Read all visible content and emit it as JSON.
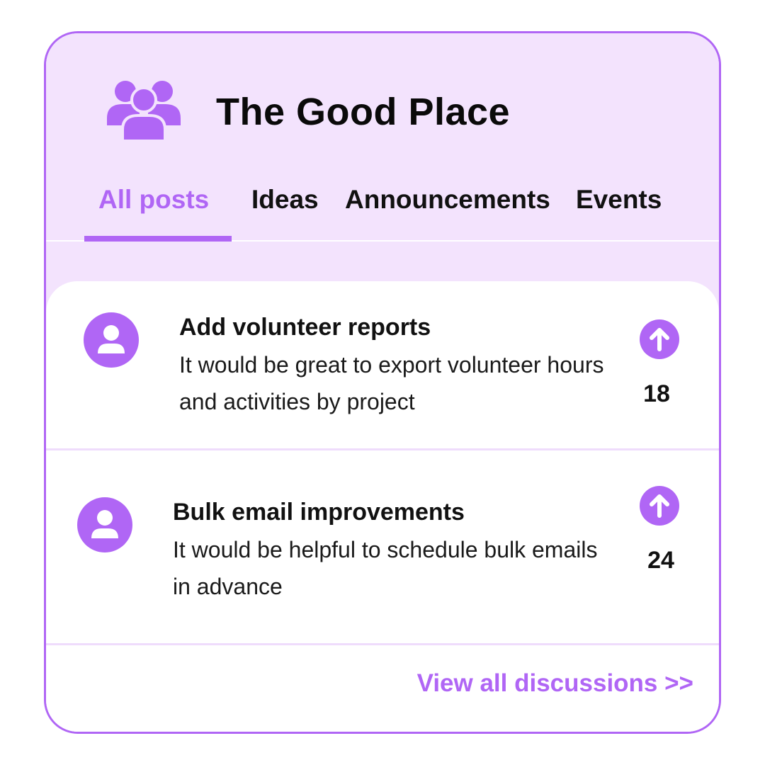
{
  "header": {
    "title": "The Good Place",
    "icon": "users-group-icon"
  },
  "tabs": [
    {
      "label": "All posts",
      "active": true
    },
    {
      "label": "Ideas",
      "active": false
    },
    {
      "label": "Announcements",
      "active": false
    },
    {
      "label": "Events",
      "active": false
    }
  ],
  "posts": [
    {
      "title": "Add volunteer reports",
      "body": "It would be great to export volunteer hours and activities by project",
      "votes": "18",
      "avatar_icon": "user-avatar-icon",
      "vote_icon": "arrow-up-icon"
    },
    {
      "title": "Bulk email improvements",
      "body": "It would be helpful to schedule bulk emails in advance",
      "votes": "24",
      "avatar_icon": "user-avatar-icon",
      "vote_icon": "arrow-up-icon"
    }
  ],
  "footer": {
    "view_all_label": "View all discussions >>"
  },
  "colors": {
    "accent": "#b066f5",
    "header_bg": "#f3e3fd",
    "divider": "#efdcfc"
  }
}
